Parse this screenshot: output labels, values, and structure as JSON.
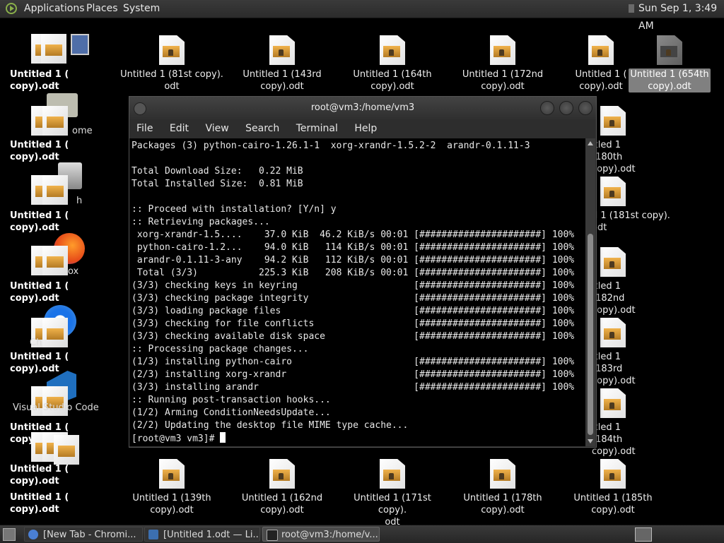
{
  "top_panel": {
    "menus": [
      "Applications",
      "Places",
      "System"
    ],
    "clock": "Sun Sep  1,  3:49 AM"
  },
  "desktop_icons": {
    "top_row": [
      {
        "label": "Untitled 1 (81st copy).\nodt"
      },
      {
        "label": "Untitled 1 (143rd\ncopy).odt"
      },
      {
        "label": "Untitled 1 (164th\ncopy).odt"
      },
      {
        "label": "Untitled 1 (172nd\ncopy).odt"
      },
      {
        "label": "Untitled 1 (\ncopy).odt"
      },
      {
        "label": "Untitled 1 (654th\ncopy).odt"
      }
    ],
    "right_col": [
      {
        "label": "itled 1 (180th\ncopy).odt"
      },
      {
        "label": "d 1 (181st copy).\nodt"
      },
      {
        "label": "itled 1 (182nd\ncopy).odt"
      },
      {
        "label": "itled 1 (183rd\ncopy).odt"
      },
      {
        "label": "itled 1 (184th\ncopy).odt"
      }
    ],
    "bottom_row": [
      {
        "label": "Untitled 1 (139th\ncopy).odt"
      },
      {
        "label": "Untitled 1 (162nd\ncopy).odt"
      },
      {
        "label": "Untitled 1 (171st copy).\nodt"
      },
      {
        "label": "Untitled 1 (178th\ncopy).odt"
      },
      {
        "label": "Untitled 1 (185th\ncopy).odt"
      }
    ],
    "left_stack": [
      {
        "label": "Untitled 1 (\ncopy).odt"
      },
      {
        "label": "Untitled 1 (\ncopy).odt",
        "extra": "ome"
      },
      {
        "label": "Untitled 1 (\ncopy).odt",
        "extra": "h"
      },
      {
        "label": "Untitled 1 (\ncopy).odt",
        "extra": "ox"
      },
      {
        "label": "Untitled 1 (\ncopy).odt",
        "extra": "Ch"
      },
      {
        "label": "Untitled 1 (\ncopy).odt",
        "extra": "Visual Studio Code"
      },
      {
        "label": "Untitled 1 (\ncopy).odt"
      },
      {
        "label": "Untitled 1 (\ncopy).odt"
      }
    ]
  },
  "terminal": {
    "title": "root@vm3:/home/vm3",
    "menu": [
      "File",
      "Edit",
      "View",
      "Search",
      "Terminal",
      "Help"
    ],
    "lines": [
      "Packages (3) python-cairo-1.26.1-1  xorg-xrandr-1.5.2-2  arandr-0.1.11-3",
      "",
      "Total Download Size:   0.22 MiB",
      "Total Installed Size:  0.81 MiB",
      "",
      ":: Proceed with installation? [Y/n] y",
      ":: Retrieving packages...",
      " xorg-xrandr-1.5....    37.0 KiB  46.2 KiB/s 00:01 [######################] 100%",
      " python-cairo-1.2...    94.0 KiB   114 KiB/s 00:01 [######################] 100%",
      " arandr-0.1.11-3-any    94.2 KiB   112 KiB/s 00:01 [######################] 100%",
      " Total (3/3)           225.3 KiB   208 KiB/s 00:01 [######################] 100%",
      "(3/3) checking keys in keyring                     [######################] 100%",
      "(3/3) checking package integrity                   [######################] 100%",
      "(3/3) loading package files                        [######################] 100%",
      "(3/3) checking for file conflicts                  [######################] 100%",
      "(3/3) checking available disk space                [######################] 100%",
      ":: Processing package changes...",
      "(1/3) installing python-cairo                      [######################] 100%",
      "(2/3) installing xorg-xrandr                       [######################] 100%",
      "(3/3) installing arandr                            [######################] 100%",
      ":: Running post-transaction hooks...",
      "(1/2) Arming ConditionNeedsUpdate...",
      "(2/2) Updating the desktop file MIME type cache..."
    ],
    "prompt": "[root@vm3 vm3]# "
  },
  "taskbar": {
    "tasks": [
      {
        "label": "[New Tab - Chromi...",
        "icon_color": "#4a7fd4"
      },
      {
        "label": "[Untitled 1.odt — Li...",
        "icon_color": "#3c6fb0"
      },
      {
        "label": "root@vm3:/home/v...",
        "icon_color": "#222222"
      }
    ]
  }
}
